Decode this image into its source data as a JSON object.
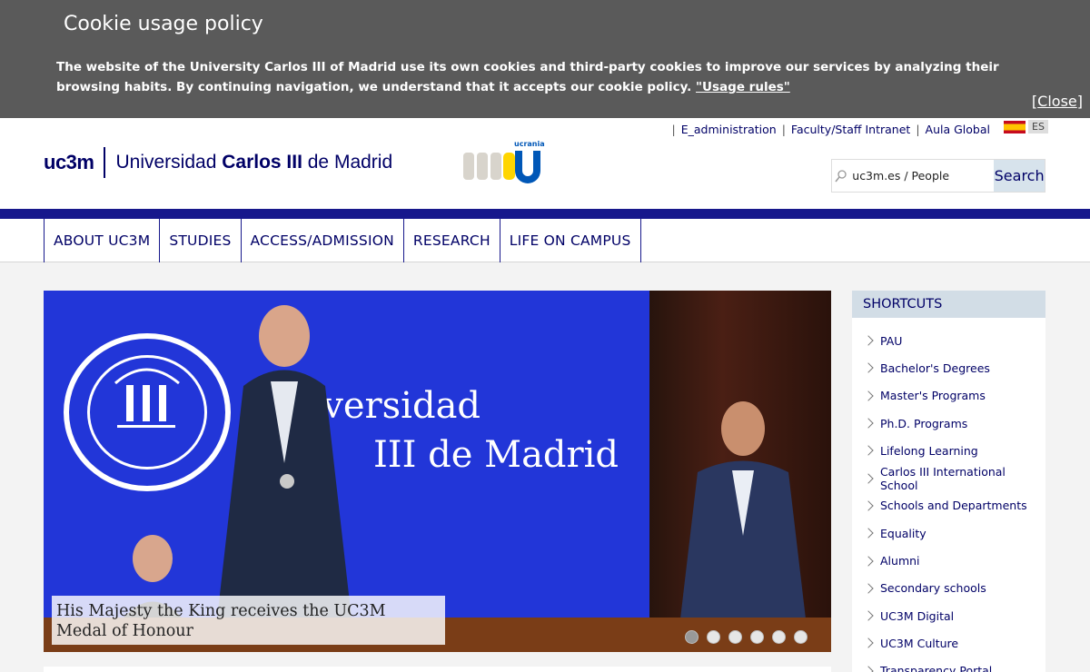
{
  "cookie": {
    "title": "Cookie usage policy",
    "text": "The website of the University Carlos III of Madrid use its own cookies and third-party cookies to improve our services by analyzing their browsing habits. By continuing navigation, we understand that it accepts our cookie policy.",
    "link": "\"Usage rules\"",
    "close": "Close"
  },
  "header": {
    "links": [
      "E_administration",
      "Faculty/Staff Intranet",
      "Aula Global"
    ],
    "lang": "ES",
    "logo_mark": "uc3m",
    "logo_name_pre": "Universidad ",
    "logo_name_bold": "Carlos III",
    "logo_name_post": " de Madrid",
    "ukraine_label": "ucrania",
    "search_value": "uc3m.es / People",
    "search_button": "Search"
  },
  "nav": [
    "ABOUT UC3M",
    "STUDIES",
    "ACCESS/ADMISSION",
    "RESEARCH",
    "LIFE ON CAMPUS"
  ],
  "hero": {
    "banner_line1": "Universidad",
    "banner_line2": "III de Madrid",
    "caption": "His Majesty the King receives the UC3M Medal of Honour",
    "slides": 6,
    "active_slide": 1
  },
  "shortcuts": {
    "title": "SHORTCUTS",
    "items": [
      "PAU",
      "Bachelor's Degrees",
      "Master's Programs",
      "Ph.D. Programs",
      "Lifelong Learning",
      "Carlos III International School",
      "Schools and Departments",
      "Equality",
      "Alumni",
      "Secondary schools",
      "UC3M Digital",
      "UC3M Culture",
      "Transparency Portal"
    ]
  },
  "colors": {
    "brand": "#000066",
    "bar": "#17188c",
    "cookie_bg": "#5a5a5a"
  }
}
